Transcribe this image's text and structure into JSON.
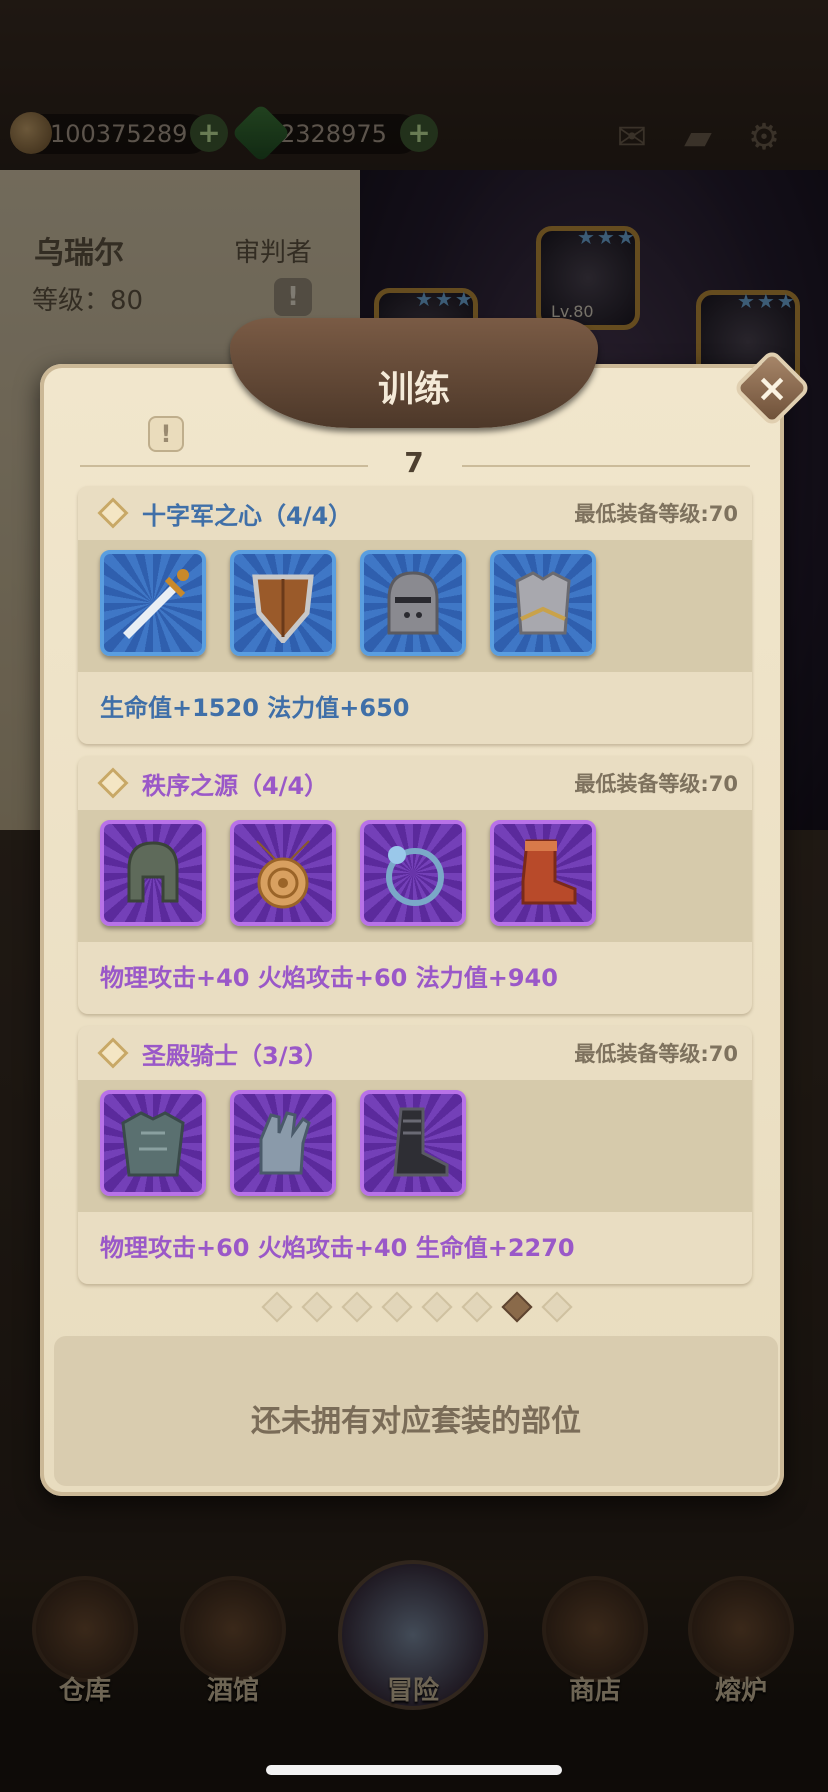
{
  "resources": {
    "gold": "100375289",
    "gems": "2328975",
    "plus": "+"
  },
  "top_icons": {
    "mail": "mail-icon",
    "book": "book-icon",
    "settings": "gear-icon"
  },
  "background_hero": {
    "name": "乌瑞尔",
    "class": "审判者",
    "level": "等级：80",
    "alert": "!",
    "portrait_level": "Lv.80"
  },
  "modal": {
    "title": "训练",
    "info": "!",
    "close": "×",
    "page_number": "7",
    "empty_message": "还未拥有对应套装的部位"
  },
  "sets": [
    {
      "name": "十字军之心（4/4）",
      "requirement": "最低装备等级:70",
      "rarity": "blue",
      "items": [
        "sword-icon",
        "shield-icon",
        "knight-helmet-icon",
        "chest-armor-icon"
      ],
      "bonus": "生命值+1520  法力值+650"
    },
    {
      "name": "秩序之源（4/4）",
      "requirement": "最低装备等级:70",
      "rarity": "purple",
      "items": [
        "helmet-icon",
        "amulet-icon",
        "ring-icon",
        "boot-icon"
      ],
      "bonus": "物理攻击+40  火焰攻击+60  法力值+940"
    },
    {
      "name": "圣殿骑士（3/3）",
      "requirement": "最低装备等级:70",
      "rarity": "purple",
      "items": [
        "plate-armor-icon",
        "gauntlet-icon",
        "greave-boot-icon"
      ],
      "bonus": "物理攻击+60  火焰攻击+40  生命值+2270"
    }
  ],
  "pager": {
    "total": 8,
    "active_index": 6
  },
  "bottom_nav": [
    {
      "label": "仓库",
      "icon": "warehouse-icon"
    },
    {
      "label": "酒馆",
      "icon": "tavern-icon"
    },
    {
      "label": "冒险",
      "icon": "adventure-icon"
    },
    {
      "label": "商店",
      "icon": "shop-icon"
    },
    {
      "label": "熔炉",
      "icon": "forge-icon"
    }
  ],
  "colors": {
    "blue_rarity": "#5a9ee0",
    "purple_rarity": "#b872e8",
    "parchment": "#f1e6cc",
    "banner": "#6a4e3a"
  }
}
